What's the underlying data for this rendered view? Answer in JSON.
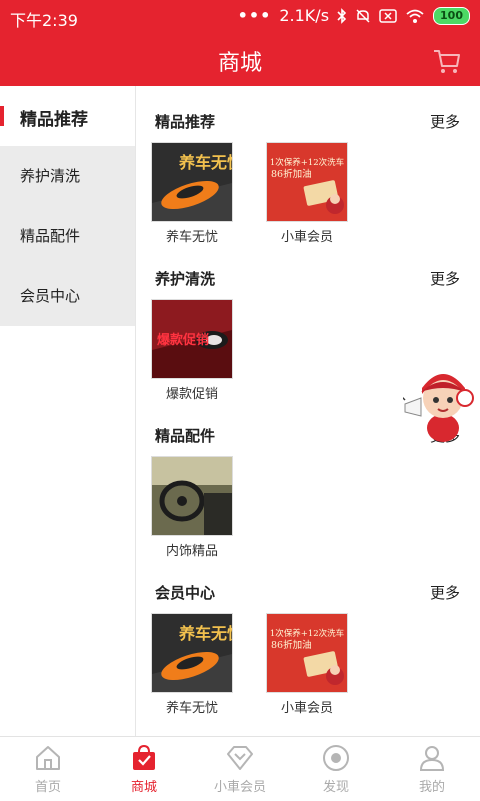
{
  "status": {
    "time": "下午2:39",
    "dots": "•••",
    "speed": "2.1K/s",
    "battery": "100"
  },
  "header": {
    "title": "商城"
  },
  "sidebar": {
    "items": [
      {
        "label": "精品推荐",
        "active": true
      },
      {
        "label": "养护清洗",
        "active": false
      },
      {
        "label": "精品配件",
        "active": false
      },
      {
        "label": "会员中心",
        "active": false
      }
    ]
  },
  "sections": [
    {
      "title": "精品推荐",
      "more": "更多",
      "items": [
        {
          "label": "养车无忧",
          "icon": "car-care-banner"
        },
        {
          "label": "小車会员",
          "icon": "membership-card-banner"
        }
      ]
    },
    {
      "title": "养护清洗",
      "more": "更多",
      "items": [
        {
          "label": "爆款促销",
          "icon": "headlight-promo-banner"
        }
      ]
    },
    {
      "title": "精品配件",
      "more": "更多",
      "items": [
        {
          "label": "内饰精品",
          "icon": "car-interior-image"
        }
      ]
    },
    {
      "title": "会员中心",
      "more": "更多",
      "items": [
        {
          "label": "养车无忧",
          "icon": "car-care-banner"
        },
        {
          "label": "小車会员",
          "icon": "membership-card-banner"
        }
      ]
    }
  ],
  "promo_text": {
    "car_care": "养车无忧",
    "member_line1": "1次保养+12次洗车",
    "member_line2": "86折加油",
    "headlight": "爆款促销"
  },
  "tabbar": {
    "items": [
      {
        "label": "首页",
        "icon": "home-icon",
        "active": false
      },
      {
        "label": "商城",
        "icon": "shopping-bag-icon",
        "active": true
      },
      {
        "label": "小車会员",
        "icon": "diamond-icon",
        "active": false
      },
      {
        "label": "发现",
        "icon": "discover-icon",
        "active": false
      },
      {
        "label": "我的",
        "icon": "profile-icon",
        "active": false
      }
    ]
  },
  "colors": {
    "brand_red": "#e5232f",
    "sidebar_bg": "#ebebeb",
    "tab_inactive": "#aaaaaa"
  }
}
